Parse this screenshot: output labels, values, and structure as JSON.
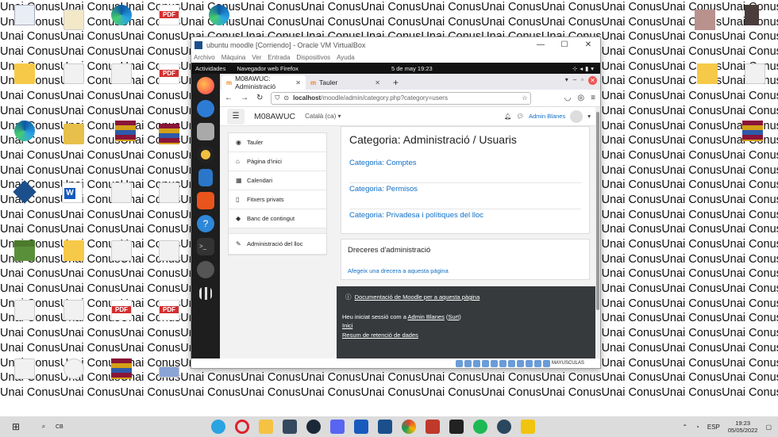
{
  "desktop": {
    "wallpaper_line": "Unai ConusUnai ConusUnai ConusUnai ConusUnai ConusUnai ConusUnai ConusUnai ConusUnai ConusUnai ConusUnai ConusUnai ConusUnai Conus",
    "wallpaper_rows": 27
  },
  "vbox": {
    "title": "ubuntu moodle [Corriendo] - Oracle VM VirtualBox",
    "menu": [
      "Archivo",
      "Máquina",
      "Ver",
      "Entrada",
      "Dispositivos",
      "Ayuda"
    ],
    "status_text": "MAYUSCULAS"
  },
  "ubuntu": {
    "activities": "Actividades",
    "app_label": "Navegador web Firefox",
    "clock": "5 de may  19:23"
  },
  "firefox": {
    "tabs": [
      {
        "label": "M08AWUC: Administració",
        "active": true
      },
      {
        "label": "Tauler",
        "active": false
      }
    ],
    "url_host": "localhost",
    "url_path": "/moodle/admin/category.php?category=users"
  },
  "moodle": {
    "site_name": "M08AWUC",
    "language": "Català (ca)",
    "user_name": "Admin Blanes",
    "nav": [
      {
        "label": "Tauler",
        "icon": "dashboard-icon"
      },
      {
        "label": "Pàgina d'inici",
        "icon": "home-icon"
      },
      {
        "label": "Calendari",
        "icon": "calendar-icon"
      },
      {
        "label": "Fitxers privats",
        "icon": "file-icon"
      },
      {
        "label": "Banc de contingut",
        "icon": "cube-icon"
      },
      {
        "label": "Administració del lloc",
        "icon": "wrench-icon"
      }
    ],
    "page_heading": "Categoria: Administració / Usuaris",
    "categories": [
      "Categoria: Comptes",
      "Categoria: Permisos",
      "Categoria: Privadesa i polítiques del lloc"
    ],
    "shortcuts_title": "Dreceres d'administració",
    "shortcuts_link": "Afegeix una drecera a aquesta pàgina",
    "footer": {
      "doc_link": "Documentació de Moodle per a aquesta pàgina",
      "logged_prefix": "Heu iniciat sessió com a ",
      "logged_user": "Admin Blanes",
      "logout": "Surt",
      "home": "Inici",
      "retention": "Resum de retenció de dades"
    }
  },
  "taskbar": {
    "cb_label": "CB",
    "lang": "ESP",
    "time": "19:23",
    "date": "05/05/2022"
  }
}
